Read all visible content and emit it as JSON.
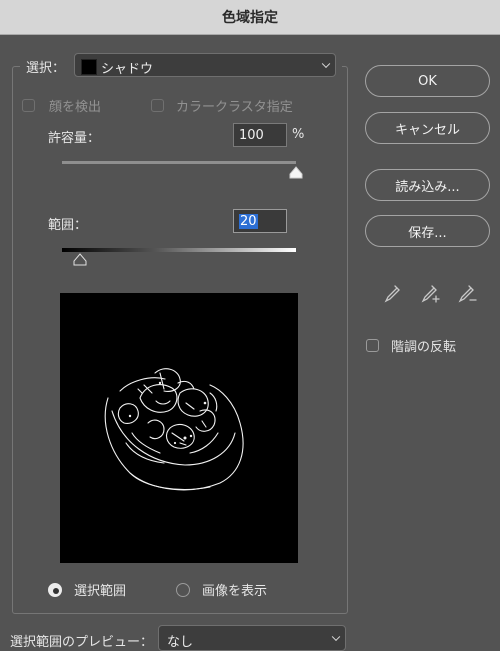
{
  "window": {
    "title": "色域指定"
  },
  "selection": {
    "label": "選択：",
    "value": "シャドウ",
    "swatch_color": "#000000"
  },
  "options": {
    "detect_faces": "顔を検出",
    "local_clusters": "カラークラスタ指定"
  },
  "fuzziness": {
    "label": "許容量：",
    "value": "100",
    "unit": "%",
    "slider_fraction": 1.0
  },
  "range": {
    "label": "範囲：",
    "value": "20",
    "slider_fraction": 0.078
  },
  "preview_mode": {
    "selection_label": "選択範囲",
    "image_label": "画像を表示",
    "selected": "selection"
  },
  "buttons": {
    "ok": "OK",
    "cancel": "キャンセル",
    "load": "読み込み...",
    "save": "保存..."
  },
  "tools": {
    "eyedropper": "eyedropper-icon",
    "eyedropper_plus": "eyedropper-plus-icon",
    "eyedropper_minus": "eyedropper-minus-icon"
  },
  "invert": {
    "label": "階調の反転"
  },
  "selection_preview": {
    "label": "選択範囲のプレビュー：",
    "value": "なし"
  }
}
